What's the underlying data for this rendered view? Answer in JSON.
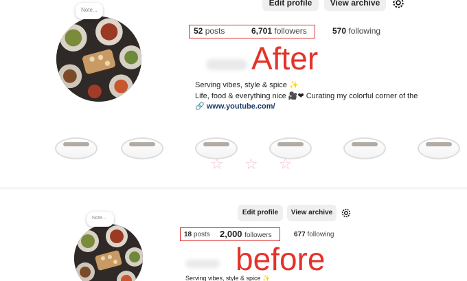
{
  "after": {
    "note": "Note...",
    "buttons": {
      "edit": "Edit profile",
      "archive": "View archive"
    },
    "stats": {
      "posts_count": "52",
      "posts_label": "posts",
      "followers_count": "6,701",
      "followers_label": "followers",
      "following_count": "570",
      "following_label": "following"
    },
    "label": "After",
    "bio": {
      "line1": "Serving vibes, style & spice ✨",
      "line2": "Life, food & everything nice 🎥❤ Curating my colorful corner of the",
      "link": "🔗 www.youtube.com/"
    },
    "decoration": "☆ ☆ ☆"
  },
  "before": {
    "note": "Note...",
    "buttons": {
      "edit": "Edit profile",
      "archive": "View archive"
    },
    "stats": {
      "posts_count": "18",
      "posts_label": "posts",
      "followers_count": "2,000",
      "followers_label": "followers",
      "following_count": "677",
      "following_label": "following"
    },
    "label": "before",
    "bio": {
      "line1": "Serving vibes, style & spice ✨"
    }
  },
  "colors": {
    "annotation_red": "#e3332a",
    "button_bg": "#efefef",
    "link": "#1b3a6b"
  },
  "icons": {
    "settings": "gear-icon",
    "avatar": "food-platter-image"
  }
}
